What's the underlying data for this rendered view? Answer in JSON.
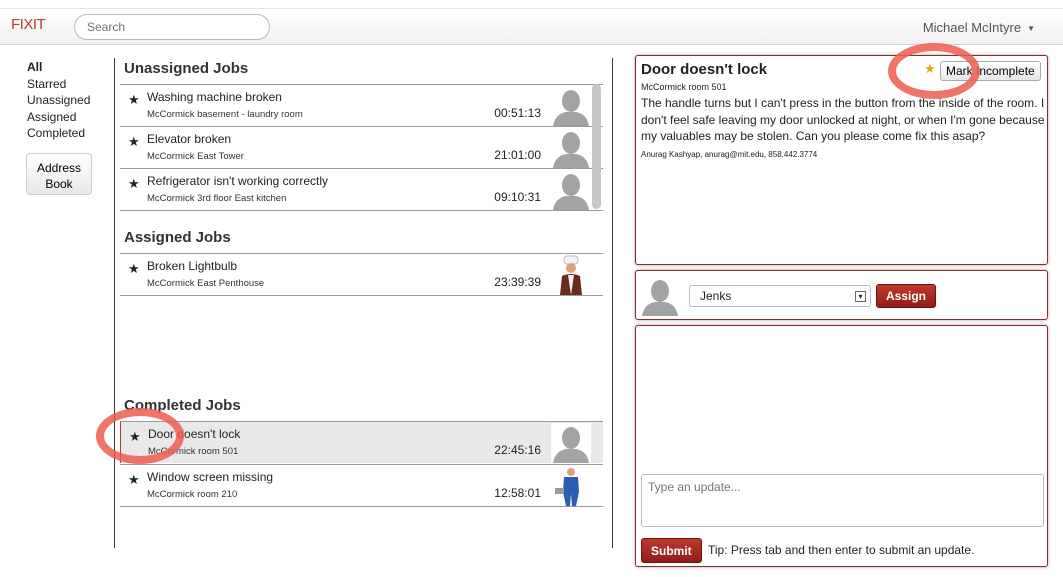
{
  "header": {
    "brand": "FIXIT",
    "search_placeholder": "Search",
    "user_name": "Michael McIntyre",
    "user_caret": "▼"
  },
  "filters": [
    "All",
    "Starred",
    "Unassigned",
    "Assigned",
    "Completed"
  ],
  "address_book": {
    "line1": "Address",
    "line2": "Book"
  },
  "sections": {
    "unassigned": "Unassigned Jobs",
    "assigned": "Assigned Jobs",
    "completed": "Completed Jobs"
  },
  "unassigned_jobs": [
    {
      "title": "Washing machine broken",
      "location": "McCormick basement - laundry room",
      "time": "00:51:13"
    },
    {
      "title": "Elevator broken",
      "location": "McCormick East Tower",
      "time": "21:01:00"
    },
    {
      "title": "Refrigerator isn't working correctly",
      "location": "McCormick 3rd floor East kitchen",
      "time": "09:10:31"
    }
  ],
  "assigned_jobs": [
    {
      "title": "Broken Lightbulb",
      "location": "McCormick East Penthouse",
      "time": "23:39:39"
    }
  ],
  "completed_jobs": [
    {
      "title": "Door doesn't lock",
      "location": "McCormick room 501",
      "time": "22:45:16"
    },
    {
      "title": "Window screen missing",
      "location": "McCormick room 210",
      "time": "12:58:01"
    }
  ],
  "detail": {
    "title": "Door doesn't lock",
    "location": "McCormick room 501",
    "description": "The handle turns but I can't press in the button from the inside of the room. I don't feel safe leaving my door unlocked at night, or when I'm gone because my valuables may be stolen. Can you please come fix this asap?",
    "contact": "Anurag Kashyap, anurag@mit.edu, 858.442.3774",
    "mark_button": "Mark Incomplete"
  },
  "assign": {
    "selected_worker": "Jenks",
    "button": "Assign"
  },
  "updates": {
    "placeholder": "Type an update...",
    "submit": "Submit",
    "tip": "Tip: Press tab and then enter to submit an update."
  },
  "colors": {
    "brand": "#c0392b",
    "accent_button": "#a82a21",
    "highlight_ring": "#ee5c4e",
    "star_active": "#e8a317"
  }
}
